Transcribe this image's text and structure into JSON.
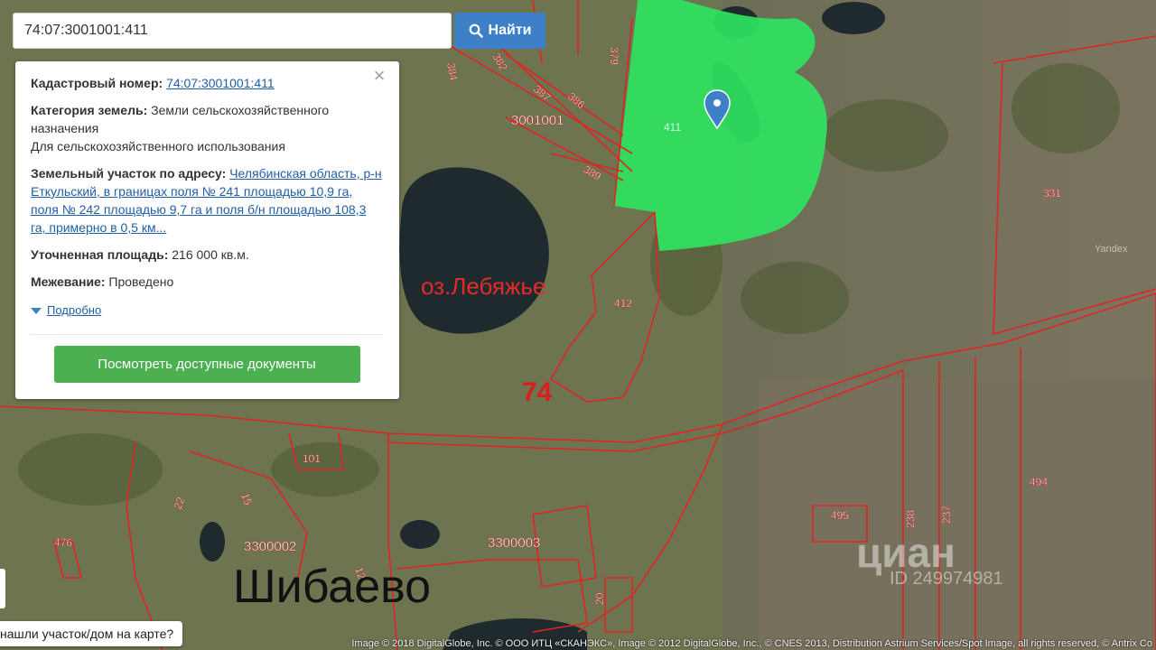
{
  "search": {
    "value": "74:07:3001001:411",
    "button_label": "Найти"
  },
  "info_panel": {
    "cadastral_label": "Кадастровый номер:",
    "cadastral_value": "74:07:3001001:411",
    "category_label": "Категория земель:",
    "category_value": "Земли сельскохозяйственного назначения",
    "category_use": "Для сельскохозяйственного использования",
    "address_label": "Земельный участок по адресу:",
    "address_value": "Челябинская область, р-н Еткульский, в границах поля № 241 площадью 10,9 га, поля № 242 площадью 9,7 га и поля б/н площадью 108,3 га, примерно в 0,5 км...",
    "area_label": "Уточненная площадь:",
    "area_value": "216 000 кв.м.",
    "survey_label": "Межевание:",
    "survey_value": "Проведено",
    "more_label": "Подробно",
    "docs_button": "Посмотреть доступные документы",
    "close_symbol": "×"
  },
  "map": {
    "lake_label": "оз.Лебяжье",
    "region_number": "74",
    "town_label": "Шибаево",
    "parcel_labels": [
      "384",
      "382",
      "379",
      "387",
      "386",
      "3001001",
      "389",
      "411",
      "331",
      "412",
      "101",
      "22",
      "15",
      "476",
      "3300002",
      "3300003",
      "12",
      "20",
      "495",
      "238",
      "237",
      "494"
    ],
    "yandex_label": "Yandex",
    "colors": {
      "selected_parcel": "#2fe35f",
      "boundary": "#e02424",
      "marker": "#3d80c7"
    }
  },
  "watermark": {
    "brand": "циан",
    "id": "ID 249974981"
  },
  "found_bar": {
    "text": "нашли участок/дом на карте?"
  },
  "copyright": "Image © 2018 DigitalGlobe, Inc. © ООО ИТЦ «СКАНЭКС», Image © 2012 DigitalGlobe, Inc., © CNES 2013, Distribution Astrium Services/Spot Image, all rights reserved, © Antrix Co"
}
